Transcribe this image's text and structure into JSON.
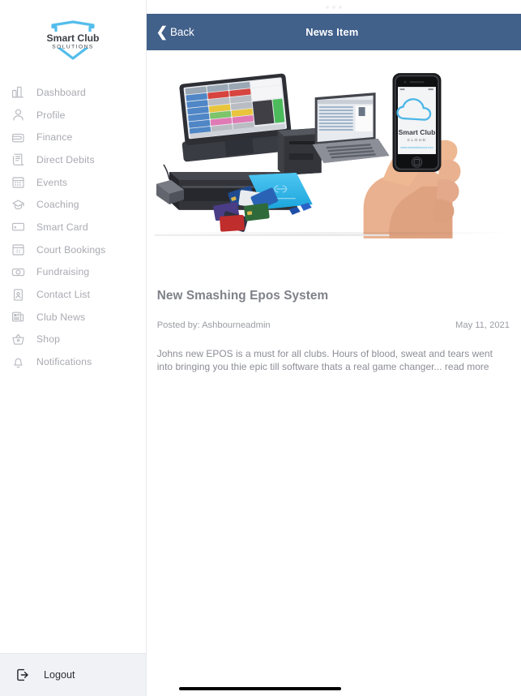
{
  "brand": {
    "logo_title": "Smart Club",
    "logo_subtitle": "SOLUTIONS",
    "shield_color": "#45b6e8",
    "wordmark_color": "#3b3f46"
  },
  "sidebar": {
    "items": [
      {
        "label": "Dashboard",
        "icon": "bar-chart-icon"
      },
      {
        "label": "Profile",
        "icon": "user-icon"
      },
      {
        "label": "Finance",
        "icon": "wallet-icon"
      },
      {
        "label": "Direct Debits",
        "icon": "receipt-icon"
      },
      {
        "label": "Events",
        "icon": "calendar-icon"
      },
      {
        "label": "Coaching",
        "icon": "graduation-cap-icon"
      },
      {
        "label": "Smart Card",
        "icon": "credit-card-icon"
      },
      {
        "label": "Court Bookings",
        "icon": "calendar-31-icon"
      },
      {
        "label": "Fundraising",
        "icon": "cash-icon"
      },
      {
        "label": "Contact List",
        "icon": "contact-card-icon"
      },
      {
        "label": "Club News",
        "icon": "newspaper-icon"
      },
      {
        "label": "Shop",
        "icon": "shopping-basket-icon"
      },
      {
        "label": "Notifications",
        "icon": "bell-icon"
      }
    ],
    "logout": {
      "label": "Logout",
      "icon": "logout-icon"
    },
    "item_text_color": "#a9aab1"
  },
  "topbar": {
    "back_label": "Back",
    "back_icon": "chevron-left-icon",
    "title": "News Item",
    "background_color": "#41608a",
    "text_color": "#ffffff"
  },
  "hero": {
    "alt": "EPOS system product photo: touchscreen till, cash drawer, receipt printer, laptop, membership cards and a hand holding a smartphone",
    "phone_screen": {
      "title": "Smart Club",
      "subtitle": "CLOUD",
      "url": "www.smartclubcloud.com",
      "cloud_color": "#45b6e8"
    }
  },
  "article": {
    "title": "New Smashing Epos System",
    "posted_by": "Posted by: Ashbourneadmin",
    "date": "May 11, 2021",
    "body": "Johns new EPOS is a must for all clubs. Hours of blood, sweat and tears went into bringing you thie epic till software thats a real game changer...",
    "read_more": "read more"
  },
  "status_bar": {
    "dot_count": 3
  }
}
